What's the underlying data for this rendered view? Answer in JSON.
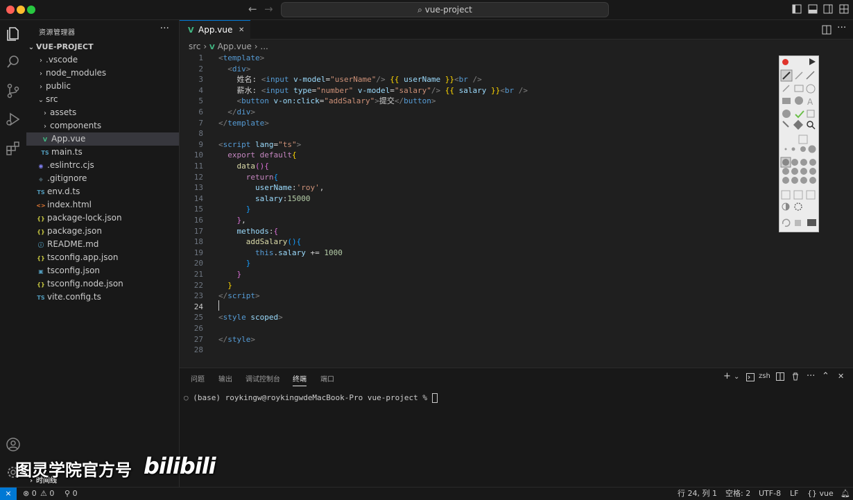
{
  "window": {
    "title": "vue-project",
    "traffic_lights": {
      "close": "#ff5f57",
      "minimize": "#febc2e",
      "zoom": "#28c840"
    },
    "nav_back": "←",
    "nav_forward": "→",
    "search_icon": "⌕"
  },
  "sidebar": {
    "title": "资源管理器",
    "more": "···",
    "project": "VUE-PROJECT",
    "items": [
      {
        "label": ".vscode",
        "icon": "chevron-right",
        "depth": 1,
        "kind": "folder"
      },
      {
        "label": "node_modules",
        "icon": "chevron-right",
        "depth": 1,
        "kind": "folder"
      },
      {
        "label": "public",
        "icon": "chevron-right",
        "depth": 1,
        "kind": "folder"
      },
      {
        "label": "src",
        "icon": "chevron-down",
        "depth": 1,
        "kind": "folder"
      },
      {
        "label": "assets",
        "icon": "chevron-right",
        "depth": 2,
        "kind": "folder"
      },
      {
        "label": "components",
        "icon": "chevron-right",
        "depth": 2,
        "kind": "folder"
      },
      {
        "label": "App.vue",
        "icon": "vue-icon",
        "depth": 2,
        "kind": "file",
        "active": true
      },
      {
        "label": "main.ts",
        "icon": "TS",
        "depth": 2,
        "kind": "file"
      },
      {
        "label": ".eslintrc.cjs",
        "icon": "eslint-icon",
        "depth": 1,
        "kind": "file"
      },
      {
        "label": ".gitignore",
        "icon": "git-icon",
        "depth": 1,
        "kind": "file"
      },
      {
        "label": "env.d.ts",
        "icon": "TS",
        "depth": 1,
        "kind": "file"
      },
      {
        "label": "index.html",
        "icon": "<>",
        "depth": 1,
        "kind": "file"
      },
      {
        "label": "package-lock.json",
        "icon": "{}",
        "depth": 1,
        "kind": "file"
      },
      {
        "label": "package.json",
        "icon": "{}",
        "depth": 1,
        "kind": "file"
      },
      {
        "label": "README.md",
        "icon": "info-icon",
        "depth": 1,
        "kind": "file"
      },
      {
        "label": "tsconfig.app.json",
        "icon": "{}",
        "depth": 1,
        "kind": "file"
      },
      {
        "label": "tsconfig.json",
        "icon": "tsconfig-icon",
        "depth": 1,
        "kind": "file"
      },
      {
        "label": "tsconfig.node.json",
        "icon": "{}",
        "depth": 1,
        "kind": "file"
      },
      {
        "label": "vite.config.ts",
        "icon": "TS",
        "depth": 1,
        "kind": "file"
      }
    ],
    "timeline": "时间线"
  },
  "editor": {
    "tab": {
      "label": "App.vue",
      "close": "✕"
    },
    "breadcrumb": {
      "folder": "src",
      "file": "App.vue",
      "more": "..."
    },
    "current_line": 24,
    "lines": [
      [
        [
          "t-punc",
          "<"
        ],
        [
          "t-tag",
          "template"
        ],
        [
          "t-punc",
          ">"
        ]
      ],
      [
        [
          "t-text",
          "  "
        ],
        [
          "t-punc",
          "<"
        ],
        [
          "t-tag",
          "div"
        ],
        [
          "t-punc",
          ">"
        ]
      ],
      [
        [
          "t-text",
          "    姓名: "
        ],
        [
          "t-punc",
          "<"
        ],
        [
          "t-tag",
          "input"
        ],
        [
          "t-text",
          " "
        ],
        [
          "t-attr",
          "v-model"
        ],
        [
          "t-text",
          "="
        ],
        [
          "t-str",
          "\"userName\""
        ],
        [
          "t-punc",
          "/>"
        ],
        [
          "t-text",
          " "
        ],
        [
          "t-br1",
          "{{"
        ],
        [
          "t-text",
          " "
        ],
        [
          "t-attr",
          "userName"
        ],
        [
          "t-text",
          " "
        ],
        [
          "t-br1",
          "}}"
        ],
        [
          "t-punc",
          "<"
        ],
        [
          "t-tag",
          "br"
        ],
        [
          "t-text",
          " "
        ],
        [
          "t-punc",
          "/>"
        ]
      ],
      [
        [
          "t-text",
          "    薪水: "
        ],
        [
          "t-punc",
          "<"
        ],
        [
          "t-tag",
          "input"
        ],
        [
          "t-text",
          " "
        ],
        [
          "t-attr",
          "type"
        ],
        [
          "t-text",
          "="
        ],
        [
          "t-str",
          "\"number\""
        ],
        [
          "t-text",
          " "
        ],
        [
          "t-attr",
          "v-model"
        ],
        [
          "t-text",
          "="
        ],
        [
          "t-str",
          "\"salary\""
        ],
        [
          "t-punc",
          "/>"
        ],
        [
          "t-text",
          " "
        ],
        [
          "t-br1",
          "{{"
        ],
        [
          "t-text",
          " "
        ],
        [
          "t-attr",
          "salary"
        ],
        [
          "t-text",
          " "
        ],
        [
          "t-br1",
          "}}"
        ],
        [
          "t-punc",
          "<"
        ],
        [
          "t-tag",
          "br"
        ],
        [
          "t-text",
          " "
        ],
        [
          "t-punc",
          "/>"
        ]
      ],
      [
        [
          "t-text",
          "    "
        ],
        [
          "t-punc",
          "<"
        ],
        [
          "t-tag",
          "button"
        ],
        [
          "t-text",
          " "
        ],
        [
          "t-attr",
          "v-on:click"
        ],
        [
          "t-text",
          "="
        ],
        [
          "t-str",
          "\"addSalary\""
        ],
        [
          "t-punc",
          ">"
        ],
        [
          "t-text",
          "提交"
        ],
        [
          "t-punc",
          "</"
        ],
        [
          "t-tag",
          "button"
        ],
        [
          "t-punc",
          ">"
        ]
      ],
      [
        [
          "t-text",
          "  "
        ],
        [
          "t-punc",
          "</"
        ],
        [
          "t-tag",
          "div"
        ],
        [
          "t-punc",
          ">"
        ]
      ],
      [
        [
          "t-punc",
          "</"
        ],
        [
          "t-tag",
          "template"
        ],
        [
          "t-punc",
          ">"
        ]
      ],
      [],
      [
        [
          "t-punc",
          "<"
        ],
        [
          "t-tag",
          "script"
        ],
        [
          "t-text",
          " "
        ],
        [
          "t-attr",
          "lang"
        ],
        [
          "t-text",
          "="
        ],
        [
          "t-str",
          "\"ts\""
        ],
        [
          "t-punc",
          ">"
        ]
      ],
      [
        [
          "t-text",
          "  "
        ],
        [
          "t-kw",
          "export"
        ],
        [
          "t-text",
          " "
        ],
        [
          "t-kw",
          "default"
        ],
        [
          "t-br1",
          "{"
        ]
      ],
      [
        [
          "t-text",
          "    "
        ],
        [
          "t-fn",
          "data"
        ],
        [
          "t-br2",
          "(){"
        ]
      ],
      [
        [
          "t-text",
          "      "
        ],
        [
          "t-kw",
          "return"
        ],
        [
          "t-br3",
          "{"
        ]
      ],
      [
        [
          "t-text",
          "        "
        ],
        [
          "t-attr",
          "userName"
        ],
        [
          "t-text",
          ":"
        ],
        [
          "t-str",
          "'roy'"
        ],
        [
          "t-text",
          ","
        ]
      ],
      [
        [
          "t-text",
          "        "
        ],
        [
          "t-attr",
          "salary"
        ],
        [
          "t-text",
          ":"
        ],
        [
          "t-num",
          "15000"
        ]
      ],
      [
        [
          "t-text",
          "      "
        ],
        [
          "t-br3",
          "}"
        ]
      ],
      [
        [
          "t-text",
          "    "
        ],
        [
          "t-br2",
          "}"
        ],
        [
          "t-text",
          ","
        ]
      ],
      [
        [
          "t-text",
          "    "
        ],
        [
          "t-attr",
          "methods"
        ],
        [
          "t-text",
          ":"
        ],
        [
          "t-br2",
          "{"
        ]
      ],
      [
        [
          "t-text",
          "      "
        ],
        [
          "t-fn",
          "addSalary"
        ],
        [
          "t-br3",
          "(){"
        ]
      ],
      [
        [
          "t-text",
          "        "
        ],
        [
          "t-tag",
          "this"
        ],
        [
          "t-text",
          "."
        ],
        [
          "t-attr",
          "salary"
        ],
        [
          "t-text",
          " += "
        ],
        [
          "t-num",
          "1000"
        ]
      ],
      [
        [
          "t-text",
          "      "
        ],
        [
          "t-br3",
          "}"
        ]
      ],
      [
        [
          "t-text",
          "    "
        ],
        [
          "t-br2",
          "}"
        ]
      ],
      [
        [
          "t-text",
          "  "
        ],
        [
          "t-br1",
          "}"
        ]
      ],
      [
        [
          "t-punc",
          "</"
        ],
        [
          "t-tag",
          "script"
        ],
        [
          "t-punc",
          ">"
        ]
      ],
      [],
      [
        [
          "t-punc",
          "<"
        ],
        [
          "t-tag",
          "style"
        ],
        [
          "t-text",
          " "
        ],
        [
          "t-attr",
          "scoped"
        ],
        [
          "t-punc",
          ">"
        ]
      ],
      [],
      [
        [
          "t-punc",
          "</"
        ],
        [
          "t-tag",
          "style"
        ],
        [
          "t-punc",
          ">"
        ]
      ],
      []
    ]
  },
  "panel": {
    "tabs": [
      "问题",
      "输出",
      "调试控制台",
      "终端",
      "端口"
    ],
    "active_tab": "终端",
    "shell": "zsh",
    "prompt": "(base) roykingw@roykingwdeMacBook-Pro vue-project % "
  },
  "statusbar": {
    "errors": "0",
    "warnings": "0",
    "ports": "0",
    "position": "行 24, 列 1",
    "spaces": "空格: 2",
    "encoding": "UTF-8",
    "eol": "LF",
    "language": "vue"
  },
  "overlay": {
    "watermark": "图灵学院官方号",
    "logo": "bilibili"
  },
  "colors": {
    "accent": "#0078d4",
    "bg": "#1f1f1f",
    "sidebar": "#181818"
  }
}
